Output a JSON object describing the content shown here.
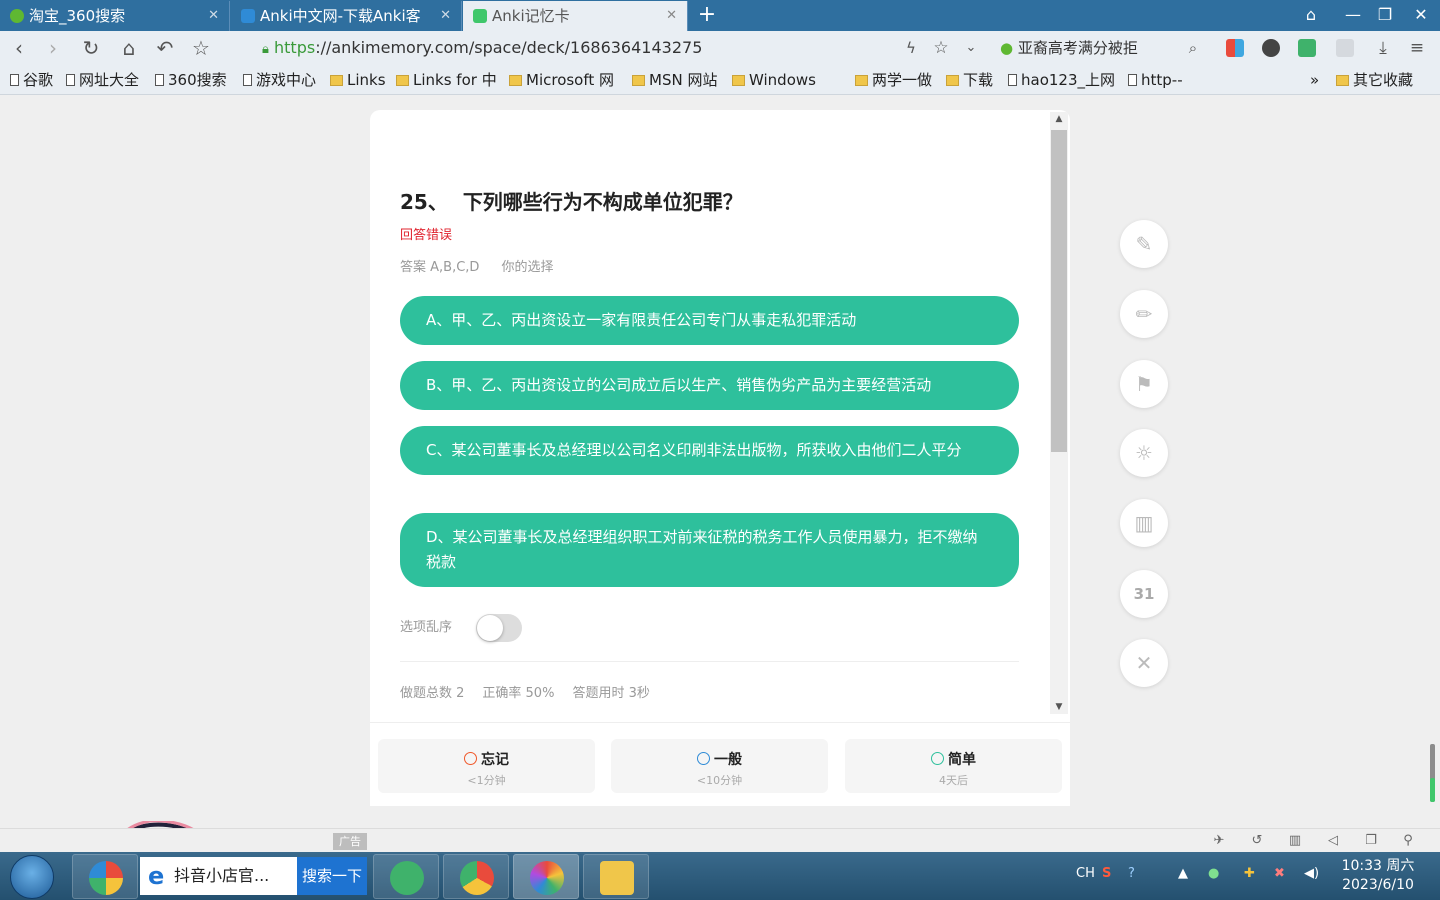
{
  "tabs": [
    {
      "label": "淘宝_360搜索",
      "active": false
    },
    {
      "label": "Anki中文网-下载Anki客",
      "active": false
    },
    {
      "label": "Anki记忆卡",
      "active": true
    }
  ],
  "address": {
    "protocol": "https",
    "url": "://ankimemory.com/space/deck/1686364143275"
  },
  "search_box": {
    "value": "亚裔高考满分被拒"
  },
  "bookmarks": [
    "谷歌",
    "网址大全",
    "360搜索",
    "游戏中心",
    "Links",
    "Links for 中",
    "Microsoft 网",
    "MSN 网站",
    "Windows",
    "两学一做",
    "下载",
    "hao123_上网",
    "http--",
    "»",
    "其它收藏"
  ],
  "question": {
    "number": "25、",
    "text": "下列哪些行为不构成单位犯罪？",
    "status": "回答错误",
    "answer": "答案 A,B,C,D",
    "your_choice": "你的选择",
    "options": [
      "A、甲、乙、丙出资设立一家有限责任公司专门从事走私犯罪活动",
      "B、甲、乙、丙出资设立的公司成立后以生产、销售伪劣产品为主要经营活动",
      "C、某公司董事长及总经理以公司名义印刷非法出版物，所获收入由他们二人平分",
      "D、某公司董事长及总经理组织职工对前来征税的税务工作人员使用暴力，拒不缴纳税款"
    ]
  },
  "shuffle_label": "选项乱序",
  "shuffle_on": false,
  "stats": {
    "total": "做题总数 2",
    "accuracy": "正确率 50%",
    "time": "答题用时 3秒"
  },
  "rating": [
    {
      "label": "忘记",
      "sub": "<1分钟",
      "color": "#f0582a"
    },
    {
      "label": "一般",
      "sub": "<10分钟",
      "color": "#2f8bd6"
    },
    {
      "label": "简单",
      "sub": "4天后",
      "color": "#2ec09c"
    }
  ],
  "side_count": "31",
  "ad_label": "广告",
  "taskbar": {
    "search_text": "抖音小店官...",
    "search_button": "搜索一下",
    "lang": "CH"
  },
  "clock": {
    "time": "10:33 周六",
    "date": "2023/6/10"
  }
}
